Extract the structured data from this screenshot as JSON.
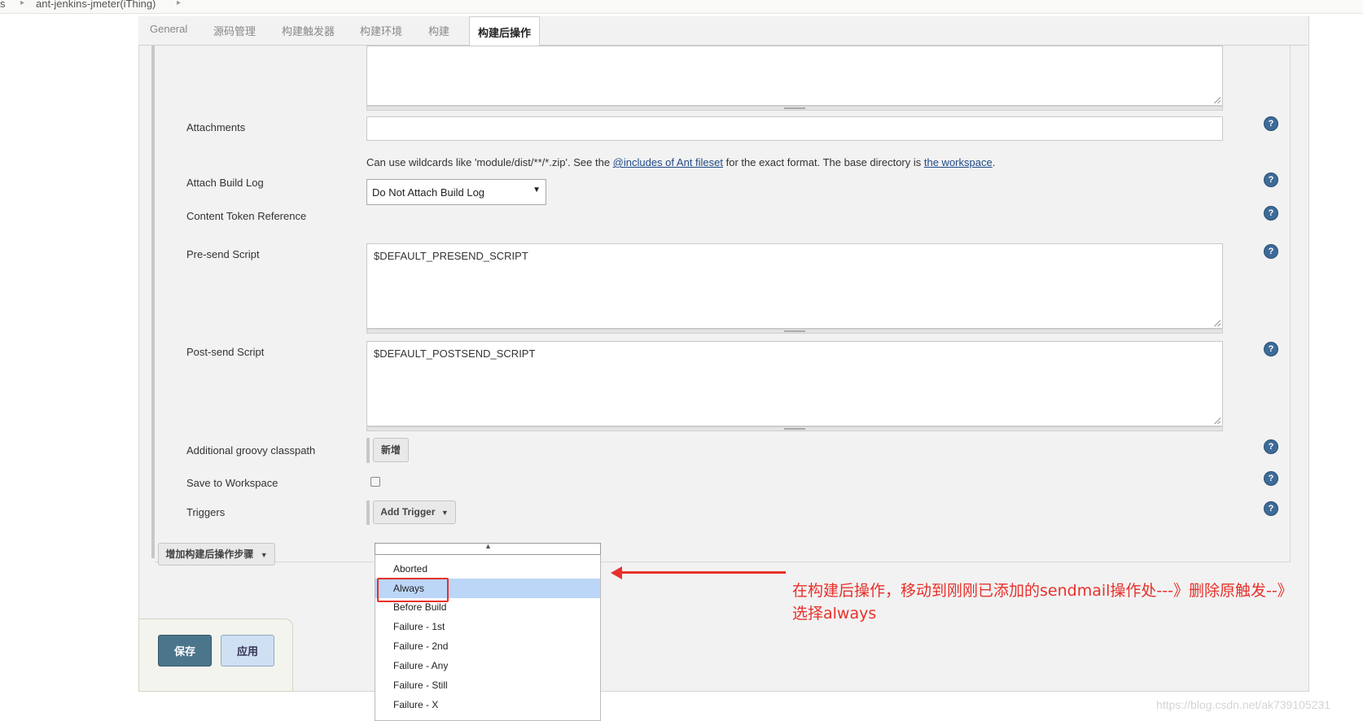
{
  "breadcrumb": {
    "item0": "s",
    "item1": "ant-jenkins-jmeter(iThing)"
  },
  "tabs": {
    "general": "General",
    "scm": "源码管理",
    "triggers": "构建触发器",
    "env": "构建环境",
    "build": "构建",
    "post": "构建后操作"
  },
  "form": {
    "attachments_label": "Attachments",
    "attachments_value": "",
    "hint_pre": "Can use wildcards like 'module/dist/**/*.zip'. See the ",
    "hint_link1": "@includes of Ant fileset",
    "hint_mid": " for the exact format. The base directory is ",
    "hint_link2": "the workspace",
    "hint_post": ".",
    "attach_build_log_label": "Attach Build Log",
    "attach_build_log_value": "Do Not Attach Build Log",
    "content_token_label": "Content Token Reference",
    "presend_label": "Pre-send Script",
    "presend_value": "$DEFAULT_PRESEND_SCRIPT",
    "postsend_label": "Post-send Script",
    "postsend_value": "$DEFAULT_POSTSEND_SCRIPT",
    "classpath_label": "Additional groovy classpath",
    "classpath_add_button": "新增",
    "save_workspace_label": "Save to Workspace",
    "save_workspace_checked": false,
    "triggers_label": "Triggers",
    "add_trigger_button": "Add Trigger",
    "help_glyph": "?"
  },
  "add_post_step_button": "增加构建后操作步骤",
  "dropdown": {
    "selected": "Always",
    "items": [
      "Aborted",
      "Always",
      "Before Build",
      "Failure - 1st",
      "Failure - 2nd",
      "Failure - Any",
      "Failure - Still",
      "Failure - X"
    ]
  },
  "annotation": {
    "line1": "在构建后操作，移动到刚刚已添加的sendmail操作处---》删除原触发--》",
    "line2": "选择always",
    "color": "#e8302a"
  },
  "buttons": {
    "save": "保存",
    "apply": "应用"
  },
  "watermark": "https://blog.csdn.net/ak739105231"
}
